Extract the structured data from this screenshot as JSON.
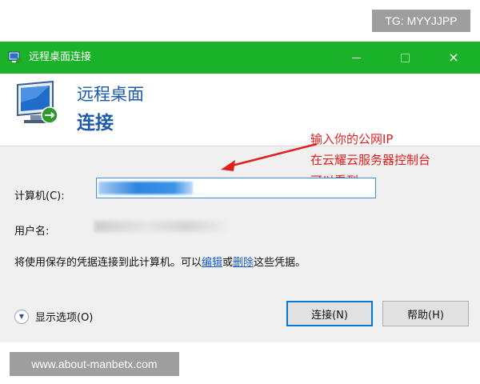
{
  "watermarks": {
    "top": "TG: MYYJJPP",
    "bottom": "www.about-manbetx.com"
  },
  "window": {
    "title": "远程桌面连接",
    "accent": "#19b229",
    "controls": {
      "minimize": "minimize-icon",
      "maximize": "maximize-icon",
      "close": "×"
    }
  },
  "banner": {
    "line1": "远程桌面",
    "line2": "连接",
    "icon": "remote-desktop-monitor-icon"
  },
  "annotation": {
    "lines": [
      "输入你的公网IP",
      "在云耀云服务器控制台",
      "可以看到"
    ],
    "color": "#e02020"
  },
  "form": {
    "computer_label": "计算机(C):",
    "computer_value_hidden": true,
    "user_label": "用户名:",
    "info_prefix": "将使用保存的凭据连接到此计算机。可以",
    "info_edit": "编辑",
    "info_or": "或",
    "info_delete": "删除",
    "info_suffix": "这些凭据。"
  },
  "footer": {
    "options_label": "显示选项(O)",
    "connect_label": "连接(N)",
    "help_label": "帮助(H)"
  }
}
